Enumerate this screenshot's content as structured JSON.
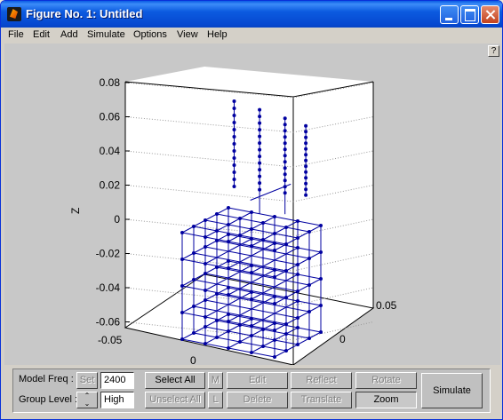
{
  "window": {
    "title": "Figure No. 1: Untitled",
    "controls": {
      "minimize_icon": "minimize-icon",
      "maximize_icon": "maximize-icon",
      "close_icon": "close-icon"
    }
  },
  "menubar": {
    "items": [
      {
        "label": "File"
      },
      {
        "label": "Edit"
      },
      {
        "label": "Add"
      },
      {
        "label": "Simulate"
      },
      {
        "label": "Options"
      },
      {
        "label": "View"
      },
      {
        "label": "Help"
      }
    ]
  },
  "help_button": {
    "label": "?"
  },
  "plot": {
    "z_label": "Z",
    "z_ticks": [
      "0.08",
      "0.06",
      "0.04",
      "0.02",
      "0",
      "-0.02",
      "-0.04",
      "-0.06"
    ],
    "x_ticks": [
      "-0.05",
      "0"
    ],
    "y_ticks": [
      "0.05",
      "0"
    ],
    "series_color": "#0000a0"
  },
  "controls": {
    "model_freq_label": "Model Freq :",
    "set_button": "Set",
    "model_freq_value": "2400",
    "group_level_label": "Group Level :",
    "group_level_value": "High",
    "select_all": "Select All",
    "m_button": "M",
    "unselect_all": "Unselect All",
    "l_button": "L",
    "edit": "Edit",
    "delete": "Delete",
    "reflect": "Reflect",
    "translate": "Translate",
    "rotate": "Rotate",
    "zoom": "Zoom",
    "simulate": "Simulate"
  }
}
